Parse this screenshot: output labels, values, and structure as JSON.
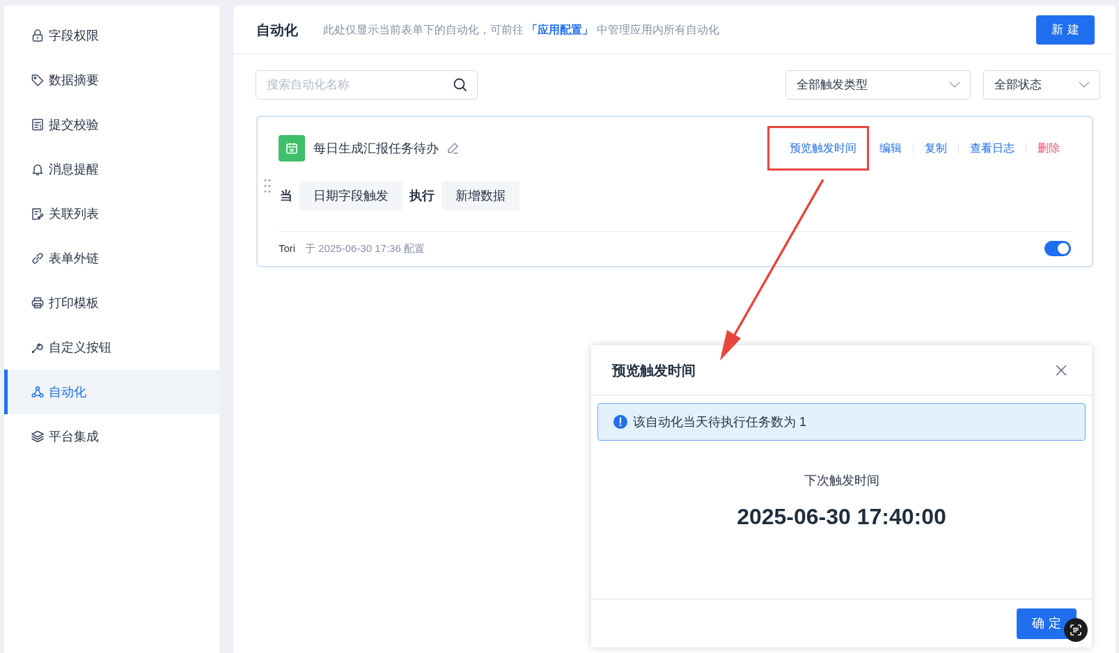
{
  "sidebar": {
    "items": [
      {
        "label": "字段权限",
        "selected": false
      },
      {
        "label": "数据摘要",
        "selected": false
      },
      {
        "label": "提交校验",
        "selected": false
      },
      {
        "label": "消息提醒",
        "selected": false
      },
      {
        "label": "关联列表",
        "selected": false
      },
      {
        "label": "表单外链",
        "selected": false
      },
      {
        "label": "打印模板",
        "selected": false
      },
      {
        "label": "自定义按钮",
        "selected": false
      },
      {
        "label": "自动化",
        "selected": true
      },
      {
        "label": "平台集成",
        "selected": false
      }
    ]
  },
  "header": {
    "title": "自动化",
    "description_before": "此处仅显示当前表单下的自动化，可前往",
    "link": "「应用配置」",
    "description_after": "中管理应用内所有自动化",
    "new_button": "新建"
  },
  "filters": {
    "search": {
      "placeholder": "搜索自动化名称"
    },
    "selects": [
      "全部触发类型",
      "全部状态"
    ]
  },
  "automation_card": {
    "name": "每日生成汇报任务待办",
    "actions": [
      {
        "label": "预览触发时间",
        "kind": "link",
        "annotated": true
      },
      {
        "label": "编辑",
        "kind": "link",
        "annotated": false
      },
      {
        "label": "复制",
        "kind": "link",
        "annotated": false
      },
      {
        "label": "查看日志",
        "kind": "link",
        "annotated": false
      },
      {
        "label": "删除",
        "kind": "danger",
        "annotated": false
      }
    ],
    "flow": [
      {
        "kind": "keyword",
        "text": "当"
      },
      {
        "kind": "chip",
        "text": "日期字段触发"
      },
      {
        "kind": "keyword",
        "text": "执行"
      },
      {
        "kind": "chip",
        "text": "新增数据"
      }
    ],
    "author": "Tori",
    "meta": "于 2025-06-30 17:36 配置",
    "enabled": true
  },
  "dialog": {
    "title": "预览触发时间",
    "alert": "该自动化当天待执行任务数为 1",
    "next_label": "下次触发时间",
    "next_time": "2025-06-30 17:40:00",
    "ok_button": "确定"
  }
}
